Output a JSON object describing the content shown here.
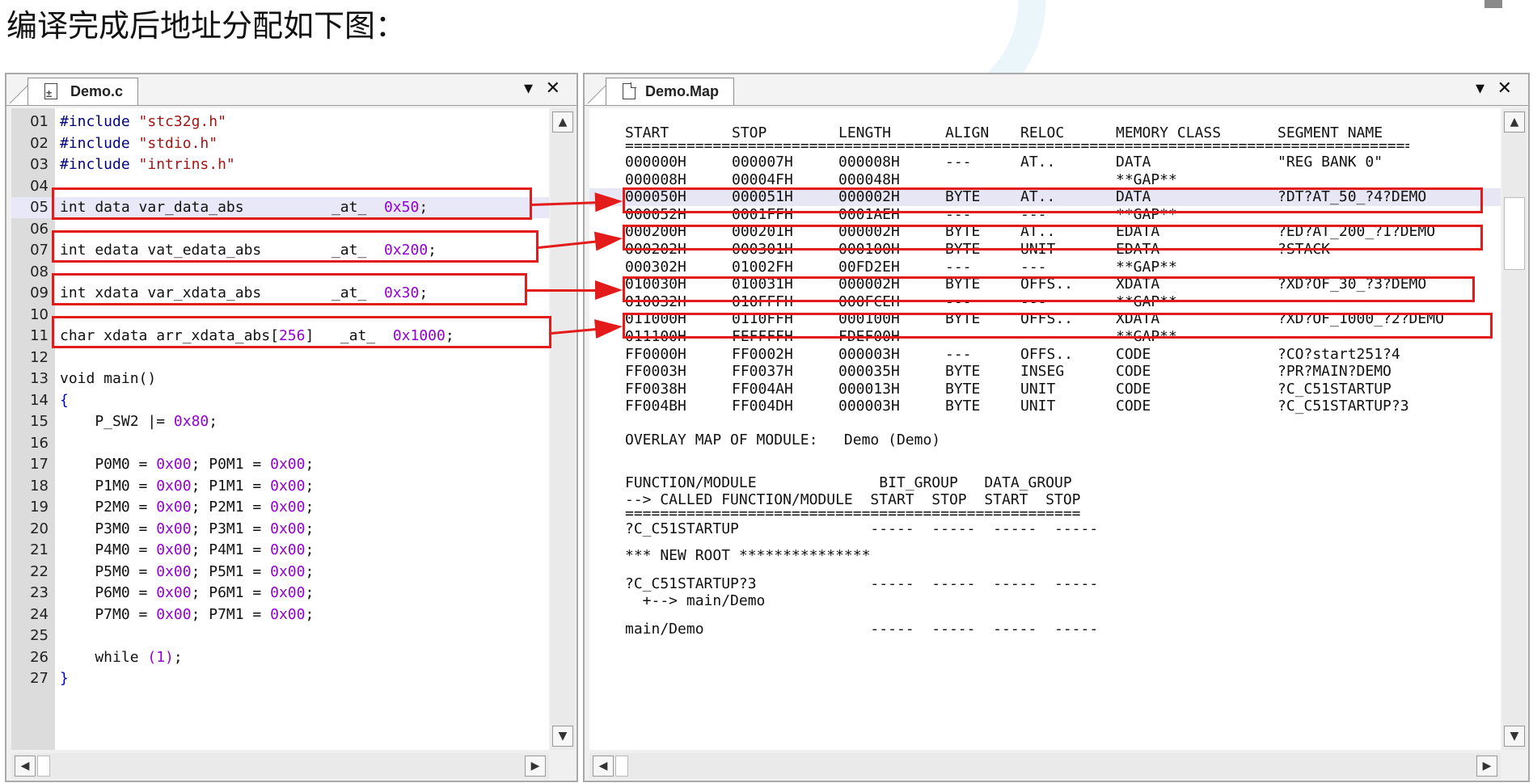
{
  "caption": "编译完成后地址分配如下图：",
  "colors": {
    "highlight_box": "#e31b1b",
    "preprocessor": "#000080",
    "string": "#a31515",
    "number": "#9400d3"
  },
  "editor": {
    "tab_label": "Demo.c",
    "tab_icon": "c-file-icon",
    "lines": [
      {
        "n": "01",
        "segs": [
          [
            "pp",
            "#include "
          ],
          [
            "str",
            "\"stc32g.h\""
          ]
        ]
      },
      {
        "n": "02",
        "segs": [
          [
            "pp",
            "#include "
          ],
          [
            "str",
            "\"stdio.h\""
          ]
        ]
      },
      {
        "n": "03",
        "segs": [
          [
            "pp",
            "#include "
          ],
          [
            "str",
            "\"intrins.h\""
          ]
        ]
      },
      {
        "n": "04",
        "segs": []
      },
      {
        "n": "05",
        "segs": [
          [
            "kw",
            "int data var_data_abs          _at_  "
          ],
          [
            "num",
            "0x50"
          ],
          [
            "kw",
            ";"
          ]
        ]
      },
      {
        "n": "06",
        "segs": []
      },
      {
        "n": "07",
        "segs": [
          [
            "kw",
            "int edata vat_edata_abs        _at_  "
          ],
          [
            "num",
            "0x200"
          ],
          [
            "kw",
            ";"
          ]
        ]
      },
      {
        "n": "08",
        "segs": []
      },
      {
        "n": "09",
        "segs": [
          [
            "kw",
            "int xdata var_xdata_abs        _at_  "
          ],
          [
            "num",
            "0x30"
          ],
          [
            "kw",
            ";"
          ]
        ]
      },
      {
        "n": "10",
        "segs": []
      },
      {
        "n": "11",
        "segs": [
          [
            "kw",
            "char xdata arr_xdata_abs["
          ],
          [
            "num",
            "256"
          ],
          [
            "kw",
            "]   _at_  "
          ],
          [
            "num",
            "0x1000"
          ],
          [
            "kw",
            ";"
          ]
        ]
      },
      {
        "n": "12",
        "segs": []
      },
      {
        "n": "13",
        "segs": [
          [
            "kw",
            "void main()"
          ]
        ]
      },
      {
        "n": "14",
        "segs": [
          [
            "brace",
            "{"
          ]
        ]
      },
      {
        "n": "15",
        "segs": [
          [
            "kw",
            "    P_SW2 |= "
          ],
          [
            "num",
            "0x80"
          ],
          [
            "kw",
            ";"
          ]
        ]
      },
      {
        "n": "16",
        "segs": []
      },
      {
        "n": "17",
        "segs": [
          [
            "kw",
            "    P0M0 = "
          ],
          [
            "num",
            "0x00"
          ],
          [
            "kw",
            "; P0M1 = "
          ],
          [
            "num",
            "0x00"
          ],
          [
            "kw",
            ";"
          ]
        ]
      },
      {
        "n": "18",
        "segs": [
          [
            "kw",
            "    P1M0 = "
          ],
          [
            "num",
            "0x00"
          ],
          [
            "kw",
            "; P1M1 = "
          ],
          [
            "num",
            "0x00"
          ],
          [
            "kw",
            ";"
          ]
        ]
      },
      {
        "n": "19",
        "segs": [
          [
            "kw",
            "    P2M0 = "
          ],
          [
            "num",
            "0x00"
          ],
          [
            "kw",
            "; P2M1 = "
          ],
          [
            "num",
            "0x00"
          ],
          [
            "kw",
            ";"
          ]
        ]
      },
      {
        "n": "20",
        "segs": [
          [
            "kw",
            "    P3M0 = "
          ],
          [
            "num",
            "0x00"
          ],
          [
            "kw",
            "; P3M1 = "
          ],
          [
            "num",
            "0x00"
          ],
          [
            "kw",
            ";"
          ]
        ]
      },
      {
        "n": "21",
        "segs": [
          [
            "kw",
            "    P4M0 = "
          ],
          [
            "num",
            "0x00"
          ],
          [
            "kw",
            "; P4M1 = "
          ],
          [
            "num",
            "0x00"
          ],
          [
            "kw",
            ";"
          ]
        ]
      },
      {
        "n": "22",
        "segs": [
          [
            "kw",
            "    P5M0 = "
          ],
          [
            "num",
            "0x00"
          ],
          [
            "kw",
            "; P5M1 = "
          ],
          [
            "num",
            "0x00"
          ],
          [
            "kw",
            ";"
          ]
        ]
      },
      {
        "n": "23",
        "segs": [
          [
            "kw",
            "    P6M0 = "
          ],
          [
            "num",
            "0x00"
          ],
          [
            "kw",
            "; P6M1 = "
          ],
          [
            "num",
            "0x00"
          ],
          [
            "kw",
            ";"
          ]
        ]
      },
      {
        "n": "24",
        "segs": [
          [
            "kw",
            "    P7M0 = "
          ],
          [
            "num",
            "0x00"
          ],
          [
            "kw",
            "; P7M1 = "
          ],
          [
            "num",
            "0x00"
          ],
          [
            "kw",
            ";"
          ]
        ]
      },
      {
        "n": "25",
        "segs": []
      },
      {
        "n": "26",
        "segs": [
          [
            "kw",
            "    while "
          ],
          [
            "num",
            "(1)"
          ],
          [
            "kw",
            ";"
          ]
        ]
      },
      {
        "n": "27",
        "segs": [
          [
            "brace",
            "}"
          ]
        ]
      }
    ],
    "highlighted_line": "05"
  },
  "map": {
    "tab_label": "Demo.Map",
    "tab_icon": "document-icon",
    "headers": [
      "START",
      "STOP",
      "LENGTH",
      "ALIGN",
      "RELOC",
      "MEMORY CLASS",
      "SEGMENT NAME"
    ],
    "separator": "===========================================================================================",
    "rows": [
      [
        "000000H",
        "000007H",
        "000008H",
        "---",
        "AT..",
        "DATA",
        "\"REG BANK 0\""
      ],
      [
        "000008H",
        "00004FH",
        "000048H",
        "",
        "",
        "**GAP**",
        ""
      ],
      [
        "000050H",
        "000051H",
        "000002H",
        "BYTE",
        "AT..",
        "DATA",
        "?DT?AT_50_?4?DEMO"
      ],
      [
        "000052H",
        "0001FFH",
        "0001AEH",
        "---",
        "---",
        "**GAP**",
        ""
      ],
      [
        "000200H",
        "000201H",
        "000002H",
        "BYTE",
        "AT..",
        "EDATA",
        "?ED?AT_200_?1?DEMO"
      ],
      [
        "000202H",
        "000301H",
        "000100H",
        "BYTE",
        "UNIT",
        "EDATA",
        "?STACK"
      ],
      [
        "000302H",
        "01002FH",
        "00FD2EH",
        "---",
        "---",
        "**GAP**",
        ""
      ],
      [
        "010030H",
        "010031H",
        "000002H",
        "BYTE",
        "OFFS..",
        "XDATA",
        "?XD?OF_30_?3?DEMO"
      ],
      [
        "010032H",
        "010FFFH",
        "000FCEH",
        "---",
        "---",
        "**GAP**",
        ""
      ],
      [
        "011000H",
        "0110FFH",
        "000100H",
        "BYTE",
        "OFFS..",
        "XDATA",
        "?XD?OF_1000_?2?DEMO"
      ],
      [
        "011100H",
        "FEFFFFH",
        "FDEF00H",
        "---",
        "---",
        "**GAP**",
        ""
      ],
      [
        "FF0000H",
        "FF0002H",
        "000003H",
        "---",
        "OFFS..",
        "CODE",
        "?CO?start251?4"
      ],
      [
        "FF0003H",
        "FF0037H",
        "000035H",
        "BYTE",
        "INSEG",
        "CODE",
        "?PR?MAIN?DEMO"
      ],
      [
        "FF0038H",
        "FF004AH",
        "000013H",
        "BYTE",
        "UNIT",
        "CODE",
        "?C_C51STARTUP"
      ],
      [
        "FF004BH",
        "FF004DH",
        "000003H",
        "BYTE",
        "UNIT",
        "CODE",
        "?C_C51STARTUP?3"
      ]
    ],
    "overlay_title": "OVERLAY MAP OF MODULE:   Demo (Demo)",
    "overlay_header_1": "FUNCTION/MODULE              BIT_GROUP   DATA_GROUP",
    "overlay_header_2": "--> CALLED FUNCTION/MODULE  START  STOP  START  STOP",
    "overlay_separator": "====================================================",
    "overlay_lines": [
      "?C_C51STARTUP               -----  -----  -----  -----",
      "*** NEW ROOT ***************",
      "?C_C51STARTUP?3             -----  -----  -----  -----",
      "  +--> main/Demo",
      "main/Demo                   -----  -----  -----  -----"
    ]
  }
}
